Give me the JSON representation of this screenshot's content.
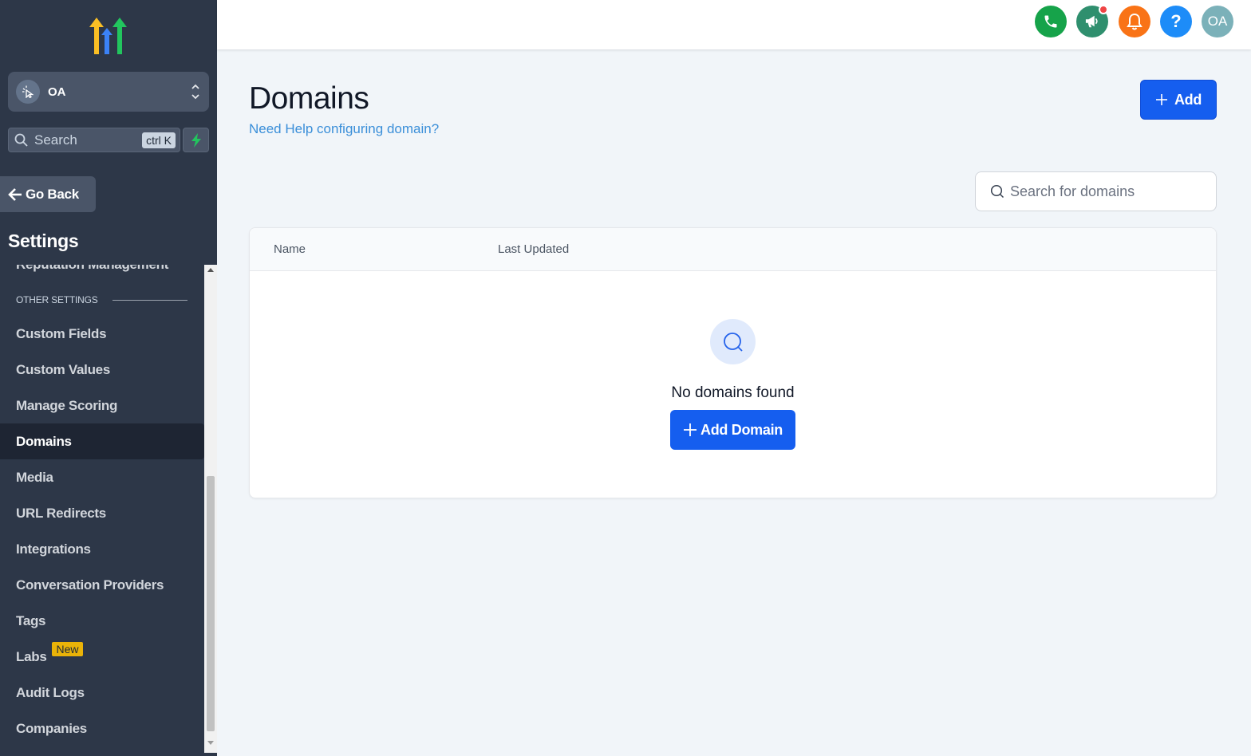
{
  "sidebar": {
    "account": {
      "name": "OA"
    },
    "search": {
      "label": "Search",
      "shortcut": "ctrl K"
    },
    "go_back_label": "Go Back",
    "title": "Settings",
    "partial_item": "Reputation Management",
    "section_header": "OTHER SETTINGS",
    "items": [
      {
        "label": "Custom Fields"
      },
      {
        "label": "Custom Values"
      },
      {
        "label": "Manage Scoring"
      },
      {
        "label": "Domains",
        "active": true
      },
      {
        "label": "Media"
      },
      {
        "label": "URL Redirects"
      },
      {
        "label": "Integrations"
      },
      {
        "label": "Conversation Providers"
      },
      {
        "label": "Tags"
      },
      {
        "label": "Labs",
        "badge": "New"
      },
      {
        "label": "Audit Logs"
      },
      {
        "label": "Companies"
      }
    ]
  },
  "topbar": {
    "icons": [
      "phone-icon",
      "megaphone-icon",
      "bell-icon",
      "help-icon"
    ],
    "help_glyph": "?",
    "user_initials": "OA",
    "colors": {
      "phone": "#16a34a",
      "announcements": "#2f8f6e",
      "notifications": "#f97316",
      "help": "#1d8cf8",
      "avatar": "#7bb1b9"
    }
  },
  "main": {
    "title": "Domains",
    "help_link": "Need Help configuring domain?",
    "add_button": "Add",
    "search_placeholder": "Search for domains",
    "table": {
      "columns": [
        "Name",
        "Last Updated"
      ],
      "rows": [],
      "empty_text": "No domains found",
      "empty_action": "Add Domain"
    }
  },
  "colors": {
    "primary": "#155eef",
    "sidebar_bg": "#2d3748",
    "link": "#3b8fd9",
    "badge": "#eab308"
  }
}
